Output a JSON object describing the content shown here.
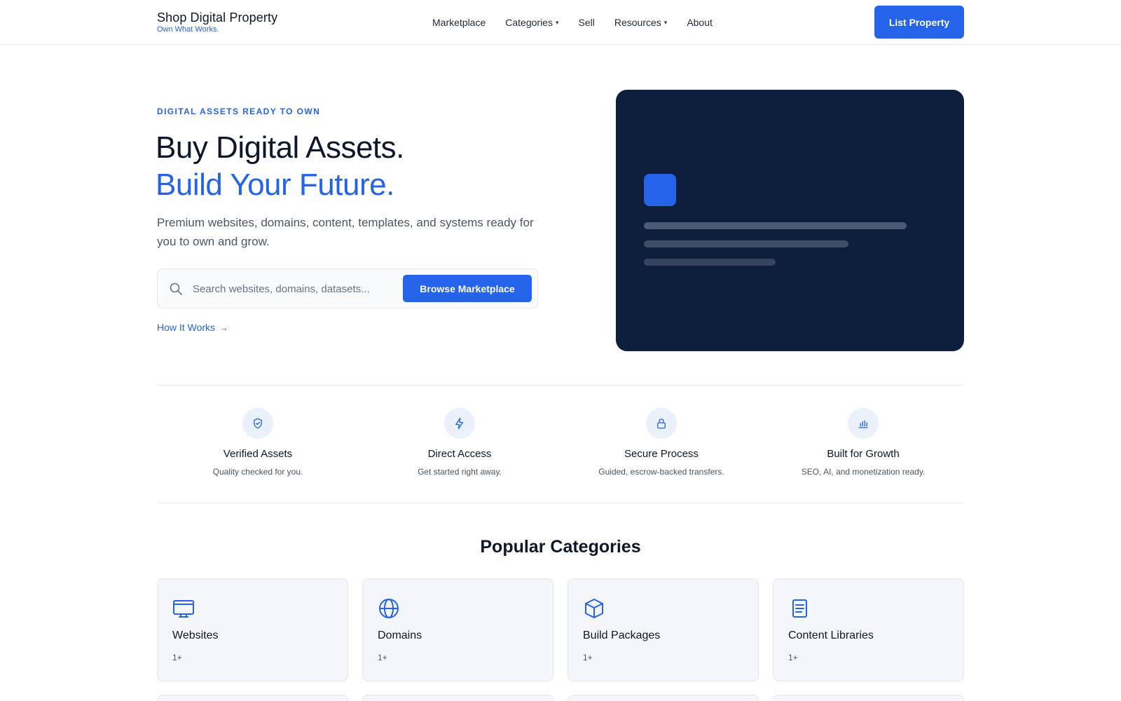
{
  "header": {
    "brand_name": "Shop Digital Property",
    "brand_tagline": "Own What Works.",
    "nav": [
      {
        "label": "Marketplace",
        "caret": false
      },
      {
        "label": "Categories",
        "caret": true
      },
      {
        "label": "Sell",
        "caret": false
      },
      {
        "label": "Resources",
        "caret": true
      },
      {
        "label": "About",
        "caret": false
      }
    ],
    "cta_label": "List Property"
  },
  "hero": {
    "eyebrow": "DIGITAL ASSETS READY TO OWN",
    "title_line1": "Buy Digital Assets.",
    "title_line2": "Build Your Future.",
    "description": "Premium websites, domains, content, templates, and systems ready for you to own and grow.",
    "search_placeholder": "Search websites, domains, datasets...",
    "search_value": "",
    "browse_label": "Browse Marketplace",
    "how_link": "How It Works"
  },
  "features": [
    {
      "icon": "shield-check-icon",
      "title": "Verified Assets",
      "desc": "Quality checked for you."
    },
    {
      "icon": "lightning-icon",
      "title": "Direct Access",
      "desc": "Get started right away."
    },
    {
      "icon": "lock-icon",
      "title": "Secure Process",
      "desc": "Guided, escrow-backed transfers."
    },
    {
      "icon": "bar-chart-icon",
      "title": "Built for Growth",
      "desc": "SEO, AI, and monetization ready."
    }
  ],
  "categories": {
    "title": "Popular Categories",
    "items": [
      {
        "icon": "monitor-icon",
        "name": "Websites",
        "count": "1+"
      },
      {
        "icon": "globe-icon",
        "name": "Domains",
        "count": "1+"
      },
      {
        "icon": "box-icon",
        "name": "Build Packages",
        "count": "1+"
      },
      {
        "icon": "document-icon",
        "name": "Content Libraries",
        "count": "1+"
      }
    ]
  },
  "colors": {
    "accent": "#2563eb",
    "hero_card": "#0e1e3d",
    "text": "#0f172a"
  }
}
